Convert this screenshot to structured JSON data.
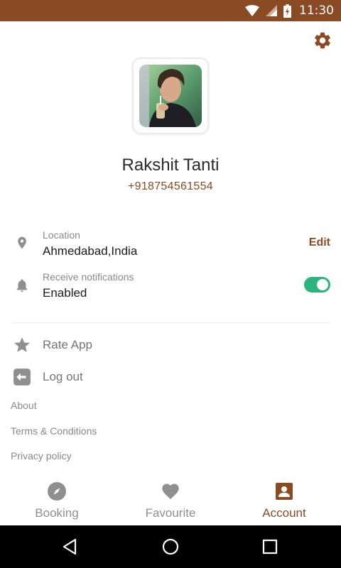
{
  "colors": {
    "brand": "#8a4a24",
    "toggle_on": "#2bb57d",
    "muted_text": "#8a8a8a",
    "icon_gray": "#8f8f8f"
  },
  "status_bar": {
    "time": "11:30",
    "icons": [
      "wifi-icon",
      "cell-signal-icon",
      "battery-charging-icon"
    ]
  },
  "header": {
    "settings_icon": "gear-icon"
  },
  "profile": {
    "name": "Rakshit Tanti",
    "phone": "+918754561554"
  },
  "settings_rows": {
    "location": {
      "icon": "location-pin-icon",
      "label": "Location",
      "value": "Ahmedabad,India",
      "action": "Edit"
    },
    "notifications": {
      "icon": "bell-icon",
      "label": "Receive notifications",
      "value": "Enabled",
      "toggle_on": true
    }
  },
  "menu": {
    "rate_app": {
      "icon": "star-icon",
      "label": "Rate App"
    },
    "log_out": {
      "icon": "logout-icon",
      "label": "Log out"
    }
  },
  "links": {
    "about": "About",
    "terms": "Terms & Conditions",
    "privacy": "Privacy policy"
  },
  "bottom_nav": {
    "tabs": [
      {
        "label": "Booking",
        "icon": "compass-icon",
        "active": false
      },
      {
        "label": "Favourite",
        "icon": "heart-icon",
        "active": false
      },
      {
        "label": "Account",
        "icon": "account-icon",
        "active": true
      }
    ]
  },
  "system_nav": {
    "buttons": [
      "back-icon",
      "home-icon",
      "recents-icon"
    ]
  }
}
